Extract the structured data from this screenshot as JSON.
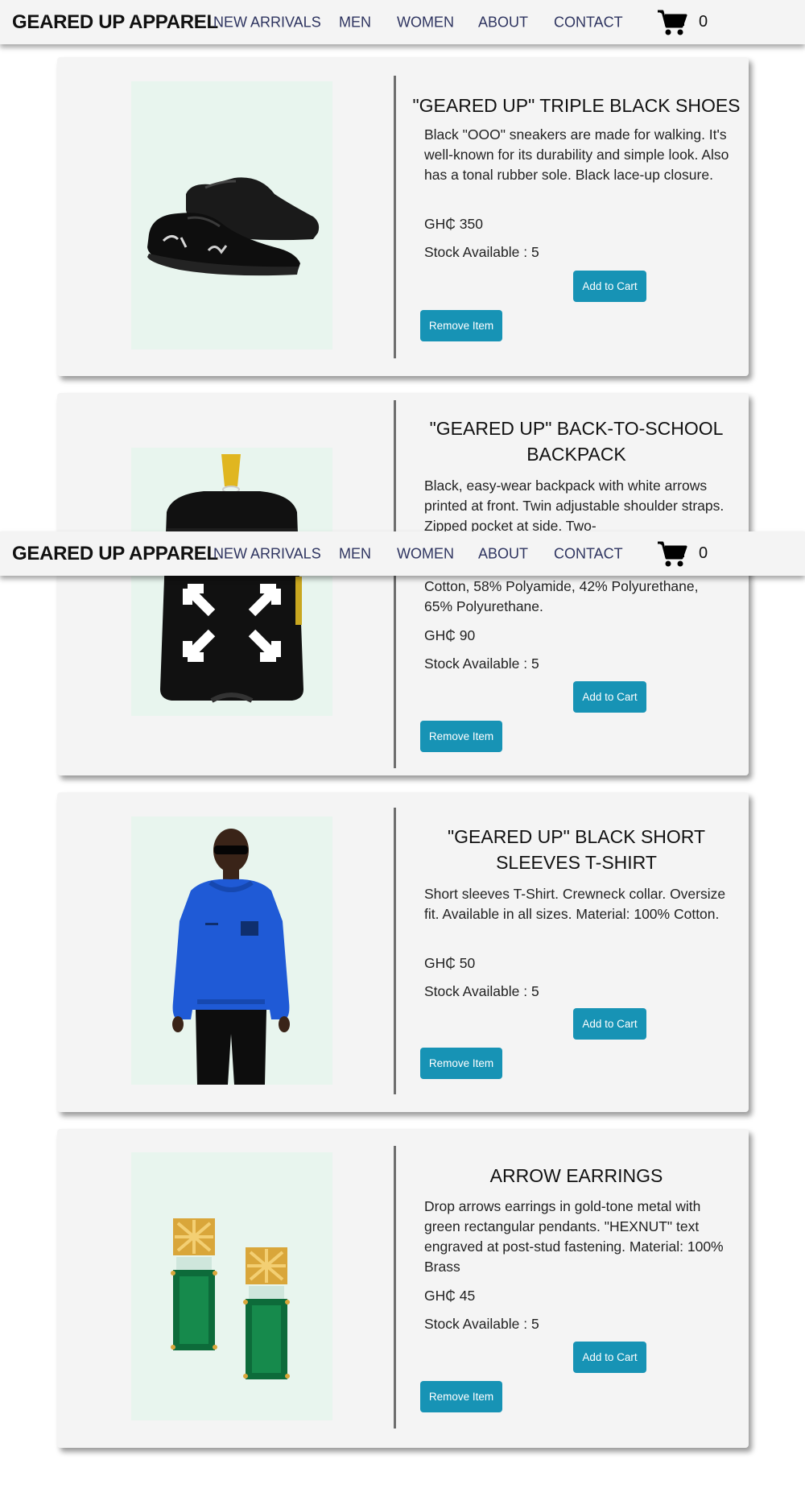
{
  "navbar": {
    "brand": "GEARED UP APPAREL",
    "links": [
      "NEW ARRIVALS",
      "MEN",
      "WOMEN",
      "ABOUT",
      "CONTACT"
    ],
    "cart_icon": "shopping-cart-icon",
    "cart_count": "0"
  },
  "colors": {
    "nav_bg": "#f4f4f4",
    "nav_link": "#2e3460",
    "card_bg": "#f4f4f4",
    "image_bg": "#e8f5ee",
    "button": "#1793b5"
  },
  "products": [
    {
      "title": "\"GEARED UP\" TRIPLE BLACK SHOES",
      "description": "Black \"OOO\" sneakers are made for walking. It's well-known for its durability and simple look. Also has a tonal rubber sole. Black lace-up closure.",
      "price": "GH₵ 350",
      "stock": "Stock Available : 5",
      "add_label": "Add to Cart",
      "remove_label": "Remove Item",
      "image": "black-sneakers-image"
    },
    {
      "title": "\"GEARED UP\" BACK-TO-SCHOOL BACKPACK",
      "description_top": "Black, easy-wear backpack with white arrows printed at front. Twin adjustable shoulder straps. Zipped pocket at side. Two-",
      "description_bottom": "Cotton, 58% Polyamide, 42% Polyurethane, 65% Polyurethane.",
      "price": "GH₵ 90",
      "stock": "Stock Available : 5",
      "add_label": "Add to Cart",
      "remove_label": "Remove Item",
      "image": "black-backpack-image"
    },
    {
      "title": "\"GEARED UP\" BLACK SHORT SLEEVES T-SHIRT",
      "description": "Short sleeves T-Shirt. Crewneck collar. Oversize fit. Available in all sizes. Material: 100% Cotton.",
      "price": "GH₵ 50",
      "stock": "Stock Available : 5",
      "add_label": "Add to Cart",
      "remove_label": "Remove Item",
      "image": "blue-hoodie-model-image"
    },
    {
      "title": "ARROW EARRINGS",
      "description": "Drop arrows earrings in gold-tone metal with green rectangular pendants. \"HEXNUT\" text engraved at post-stud fastening. Material: 100% Brass",
      "price": "GH₵ 45",
      "stock": "Stock Available : 5",
      "add_label": "Add to Cart",
      "remove_label": "Remove Item",
      "image": "green-earrings-image"
    }
  ]
}
